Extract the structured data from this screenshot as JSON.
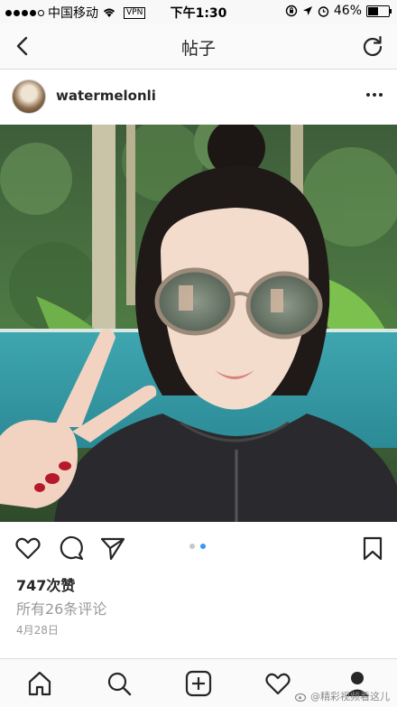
{
  "status_bar": {
    "carrier": "中国移动",
    "vpn": "VPN",
    "time": "下午1:30",
    "battery": "46%",
    "battery_level": 0.46
  },
  "nav": {
    "title": "帖子",
    "back_icon": "chevron-left-icon",
    "refresh_icon": "refresh-icon"
  },
  "post": {
    "username": "watermelonli",
    "image_icon": "selfie-photo",
    "carousel_index": 2,
    "carousel_total": 2,
    "likes": "747次赞",
    "comments_link": "所有26条评论",
    "date": "4月28日"
  },
  "tabs": [
    "home-icon",
    "search-icon",
    "add-icon",
    "heart-icon",
    "profile-icon"
  ],
  "watermark": "@精彩视频看这儿",
  "colors": {
    "accent": "#3897f0",
    "text": "#262626",
    "muted": "#999999"
  }
}
